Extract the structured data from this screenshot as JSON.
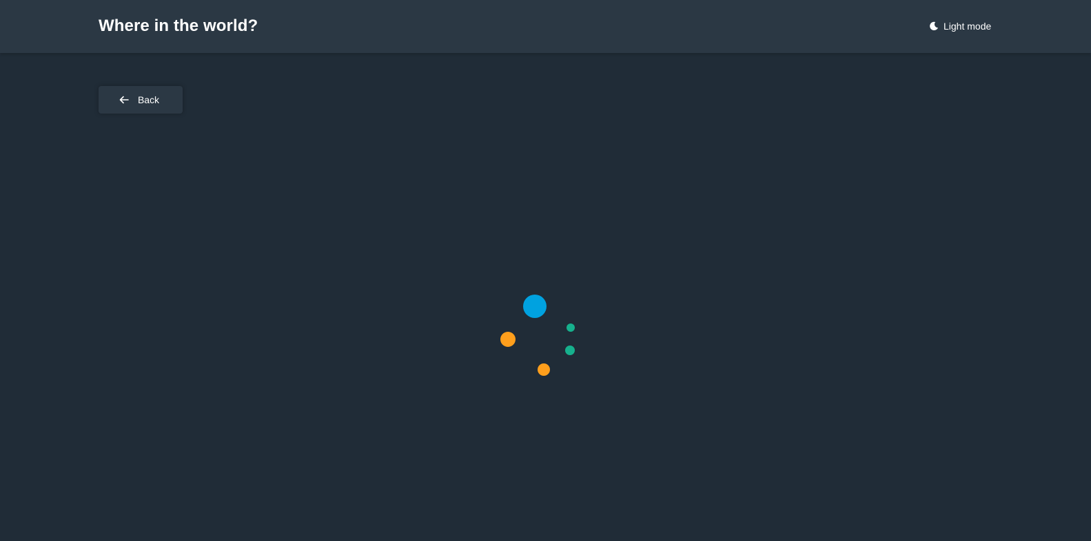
{
  "header": {
    "title": "Where in the world?",
    "theme_toggle_label": "Light mode",
    "theme_icon": "moon-icon"
  },
  "main": {
    "back_label": "Back",
    "back_icon": "arrow-left-icon"
  },
  "loader": {
    "dots": [
      {
        "name": "loader-dot-large-blue",
        "color": "#00a2e0"
      },
      {
        "name": "loader-dot-orange-left",
        "color": "#ff9f1c"
      },
      {
        "name": "loader-dot-orange-bottom",
        "color": "#ff9f1c"
      },
      {
        "name": "loader-dot-green-top",
        "color": "#16b18d"
      },
      {
        "name": "loader-dot-green-right",
        "color": "#16b18d"
      }
    ]
  },
  "colors": {
    "background": "#202c37",
    "surface": "#2b3844",
    "text": "#ffffff"
  }
}
